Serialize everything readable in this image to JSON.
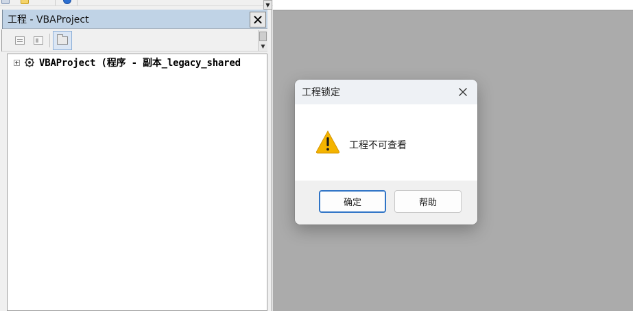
{
  "project_window": {
    "title": "工程 - VBAProject",
    "close_glyph": "✕",
    "toolbar": {
      "buttons": [
        "view-code",
        "view-object",
        "toggle-folders"
      ]
    },
    "tree": {
      "items": [
        {
          "label": "VBAProject (程序 - 副本_legacy_shared",
          "expanded": false
        }
      ]
    }
  },
  "dialog": {
    "title": "工程锁定",
    "message": "工程不可查看",
    "icon": "warning-icon",
    "buttons": {
      "ok_label": "确定",
      "help_label": "帮助"
    }
  },
  "colors": {
    "titlebar": "#c0d3e6",
    "mdi_background": "#ababab",
    "accent": "#2f74c6",
    "warning": "#f4b400"
  }
}
